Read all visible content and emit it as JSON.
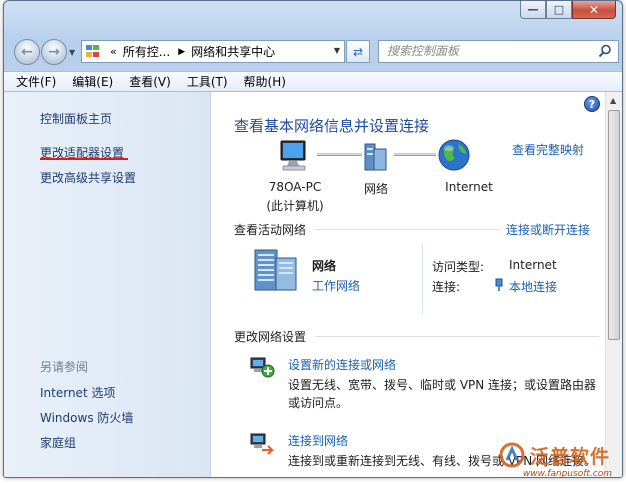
{
  "window": {
    "caption": {
      "minimize": "—",
      "maximize": "□",
      "close": "✕"
    }
  },
  "navbar": {
    "breadcrumb": [
      "所有控...",
      "网络和共享中心"
    ],
    "address_prefix": "«",
    "search_placeholder": "搜索控制面板"
  },
  "menubar": [
    "文件(F)",
    "编辑(E)",
    "查看(V)",
    "工具(T)",
    "帮助(H)"
  ],
  "sidebar": {
    "links": [
      "控制面板主页",
      "更改适配器设置",
      "更改高级共享设置"
    ],
    "see_also_title": "另请参阅",
    "see_also": [
      "Internet 选项",
      "Windows 防火墙",
      "家庭组"
    ]
  },
  "main": {
    "title": "查看基本网络信息并设置连接",
    "view_full_map": "查看完整映射",
    "map": {
      "computer": "78OA-PC",
      "computer_sub": "(此计算机)",
      "network": "网络",
      "internet": "Internet"
    },
    "active": {
      "title": "查看活动网络",
      "connect_disconnect": "连接或断开连接",
      "name": "网络",
      "type": "工作网络",
      "access_type_label": "访问类型:",
      "access_type_value": "Internet",
      "connection_label": "连接:",
      "connection_value": "本地连接"
    },
    "change": {
      "title": "更改网络设置",
      "tasks": [
        {
          "link": "设置新的连接或网络",
          "desc": "设置无线、宽带、拨号、临时或 VPN 连接；或设置路由器或访问点。"
        },
        {
          "link": "连接到网络",
          "desc": "连接到或重新连接到无线、有线、拨号或 VPN 网络连接。"
        }
      ]
    }
  },
  "watermark": {
    "text": "泛普软件",
    "url": "www.fanpusoft.com"
  },
  "colors": {
    "link": "#1a5fb4",
    "title": "#1e4a9e",
    "highlight_underline": "#e01a1a",
    "watermark": "#d46522"
  }
}
